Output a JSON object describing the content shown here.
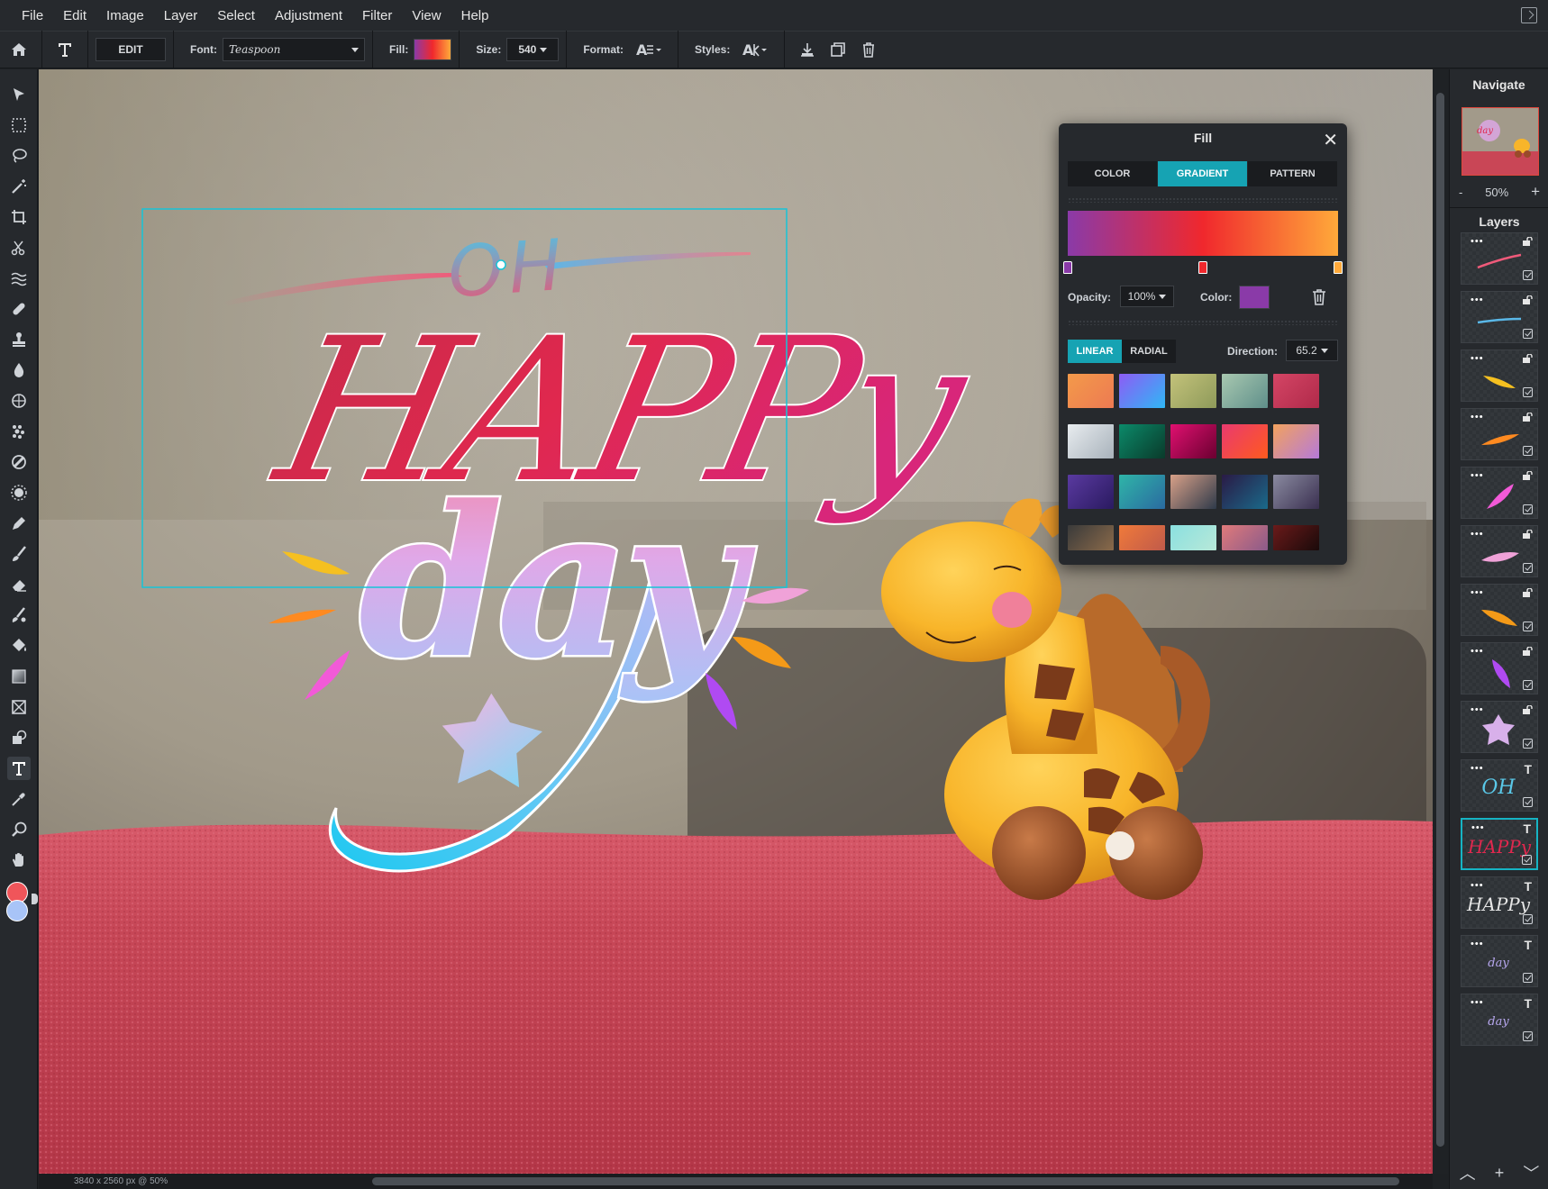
{
  "menu": [
    "File",
    "Edit",
    "Image",
    "Layer",
    "Select",
    "Adjustment",
    "Filter",
    "View",
    "Help"
  ],
  "options": {
    "edit_label": "EDIT",
    "font_label": "Font:",
    "font_value": "Teaspoon",
    "fill_label": "Fill:",
    "size_label": "Size:",
    "size_value": "540",
    "format_label": "Format:",
    "styles_label": "Styles:"
  },
  "canvas_text": {
    "oh": "OH",
    "happy": "HAPPy",
    "day": "day"
  },
  "status": "3840 x 2560 px @ 50%",
  "navigate": {
    "title": "Navigate",
    "zoom_minus": "-",
    "zoom_value": "50%",
    "zoom_plus": "+"
  },
  "layers": {
    "title": "Layers",
    "items": [
      {
        "kind": "shape",
        "art": "stroke-pink"
      },
      {
        "kind": "shape",
        "art": "stroke-blue"
      },
      {
        "kind": "shape",
        "art": "leaf-yellow"
      },
      {
        "kind": "shape",
        "art": "leaf-orange"
      },
      {
        "kind": "shape",
        "art": "leaf-magenta"
      },
      {
        "kind": "shape",
        "art": "leaf-pink"
      },
      {
        "kind": "shape",
        "art": "leaf-orange2"
      },
      {
        "kind": "shape",
        "art": "leaf-purple"
      },
      {
        "kind": "shape",
        "art": "star"
      },
      {
        "kind": "text",
        "label": "OH"
      },
      {
        "kind": "text",
        "label": "HAPPy",
        "selected": true
      },
      {
        "kind": "text",
        "label": "HAPPy"
      },
      {
        "kind": "text",
        "label": "day"
      },
      {
        "kind": "text",
        "label": "day"
      }
    ]
  },
  "fill_dialog": {
    "title": "Fill",
    "tabs": [
      "COLOR",
      "GRADIENT",
      "PATTERN"
    ],
    "active_tab": "GRADIENT",
    "opacity_label": "Opacity:",
    "opacity_value": "100%",
    "color_label": "Color:",
    "color_value": "#8a3aa8",
    "linear_label": "LINEAR",
    "radial_label": "RADIAL",
    "direction_label": "Direction:",
    "direction_value": "65.2",
    "gradient_stops": [
      "#8a3aa8",
      "#f0282d",
      "#ffa93a"
    ],
    "presets": [
      [
        "#f39a4a",
        "#ed7a52"
      ],
      [
        "#8d5cf5",
        "#2fb7f5"
      ],
      [
        "#c3c27a",
        "#8e9a5a"
      ],
      [
        "#a8c8b0",
        "#5f8f8a"
      ],
      [
        "#d44565",
        "#b02a4a"
      ],
      [
        "#e8ecef",
        "#a8b2bb"
      ],
      [
        "#0b8a6a",
        "#0a3a2a"
      ],
      [
        "#e01070",
        "#6a0030"
      ],
      [
        "#e93a6f",
        "#ff5a1e"
      ],
      [
        "#f2a25e",
        "#b57ad9"
      ],
      [
        "#5a3aa0",
        "#2a1a60"
      ],
      [
        "#2fb5a8",
        "#2a6aa0"
      ],
      [
        "#d8a088",
        "#2f3a4a"
      ],
      [
        "#2a1a45",
        "#1a6a8a"
      ],
      [
        "#8a8aa0",
        "#3a3050"
      ],
      [
        "#3a3a3a",
        "#8a6a4a"
      ],
      [
        "#f07a3a",
        "#c05a4a"
      ],
      [
        "#8ae0e0",
        "#b8e8d8"
      ],
      [
        "#e07a7a",
        "#8a5a8a"
      ],
      [
        "#6a1a1a",
        "#1a0a0a"
      ]
    ]
  }
}
